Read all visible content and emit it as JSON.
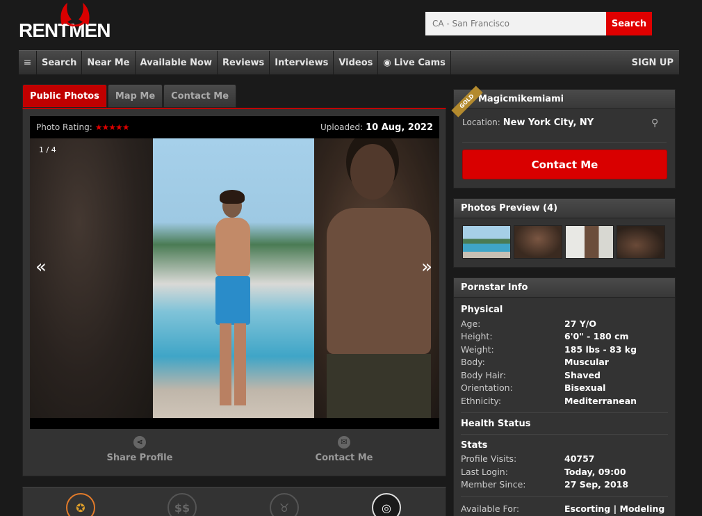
{
  "header": {
    "logo": "RENTMEN",
    "search_placeholder": "CA - San Francisco",
    "search_button": "Search"
  },
  "nav": {
    "items": [
      "Search",
      "Near Me",
      "Available Now",
      "Reviews",
      "Interviews",
      "Videos",
      "Live Cams"
    ],
    "signup": "SIGN UP"
  },
  "tabs": [
    "Public Photos",
    "Map Me",
    "Contact Me"
  ],
  "photo": {
    "rating_label": "Photo Rating:",
    "stars": "★★★★★",
    "uploaded_label": "Uploaded:",
    "uploaded_value": "10 Aug, 2022",
    "counter": "1 / 4",
    "prev": "«",
    "next": "»"
  },
  "actions": {
    "share": "Share Profile",
    "contact": "Contact Me"
  },
  "profile": {
    "badge": "GOLD",
    "name": "Magicmikemiami",
    "location_label": "Location:",
    "location_value": "New York City, NY",
    "contact_button": "Contact Me"
  },
  "preview": {
    "title": "Photos Preview (4)"
  },
  "info": {
    "title": "Pornstar Info",
    "physical_title": "Physical",
    "physical": [
      {
        "k": "Age:",
        "v": "27 Y/O"
      },
      {
        "k": "Height:",
        "v": "6'0\" - 180 cm"
      },
      {
        "k": "Weight:",
        "v": "185 lbs - 83 kg"
      },
      {
        "k": "Body:",
        "v": "Muscular"
      },
      {
        "k": "Body Hair:",
        "v": "Shaved"
      },
      {
        "k": "Orientation:",
        "v": "Bisexual"
      },
      {
        "k": "Ethnicity:",
        "v": "Mediterranean"
      }
    ],
    "health_title": "Health Status",
    "stats_title": "Stats",
    "stats": [
      {
        "k": "Profile Visits:",
        "v": "40757"
      },
      {
        "k": "Last Login:",
        "v": "Today, 09:00"
      },
      {
        "k": "Member Since:",
        "v": "27 Sep, 2018"
      }
    ],
    "available_label": "Available For:",
    "available_value": "Escorting | Modeling"
  },
  "colors": {
    "accent_red": "#d90000",
    "gold": "#b38a2e"
  }
}
